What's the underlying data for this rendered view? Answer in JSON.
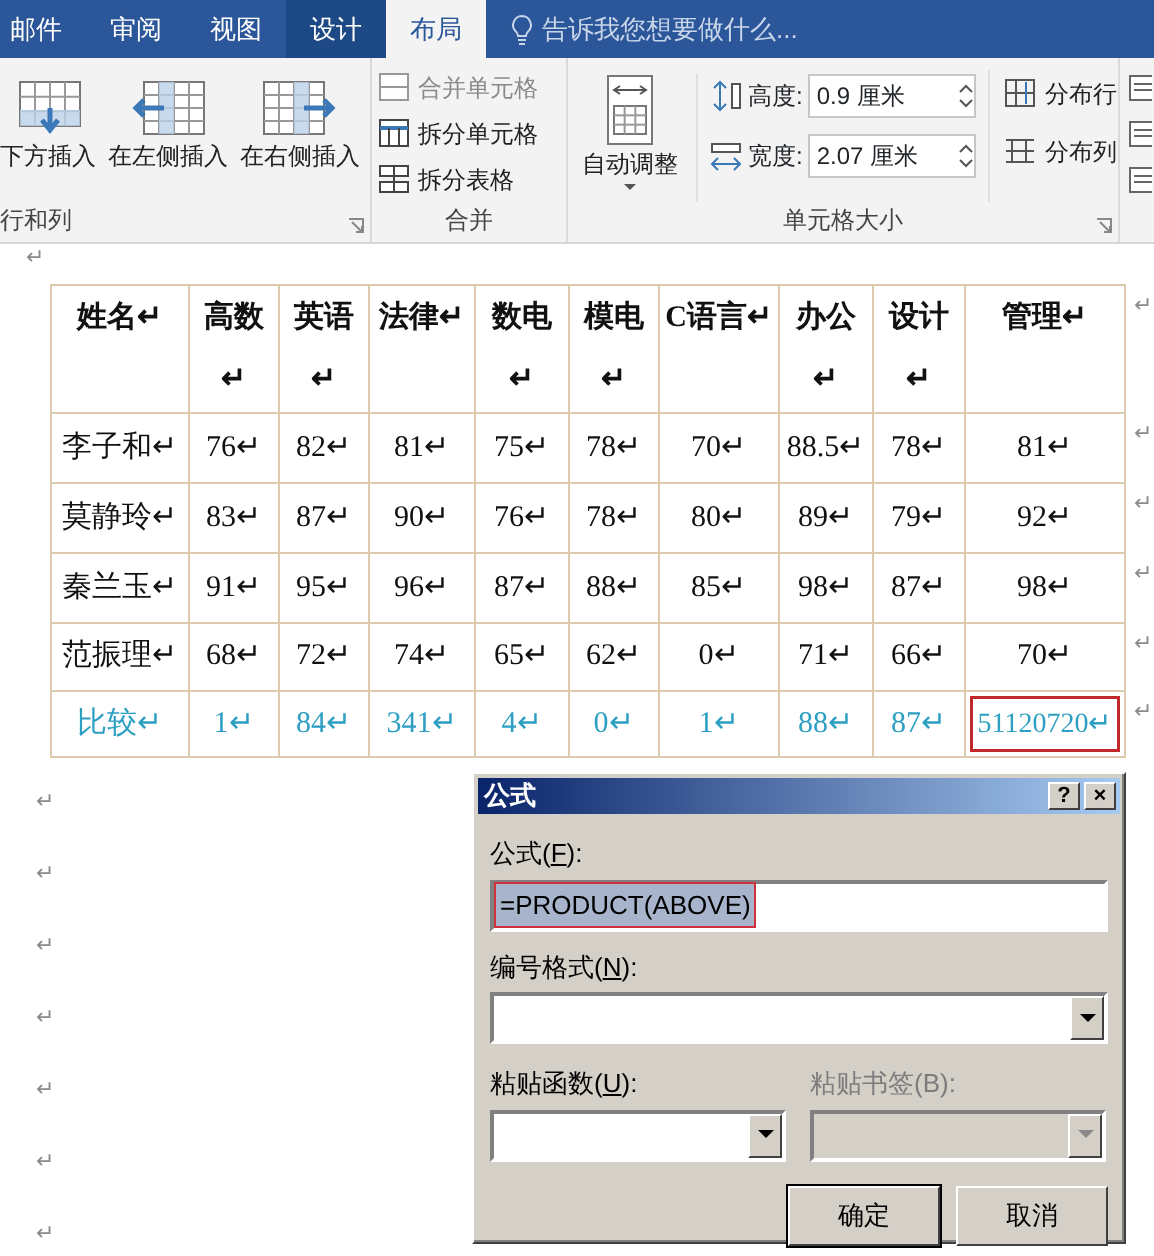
{
  "tabs": [
    {
      "label": "邮件",
      "contextual": false,
      "selected": false
    },
    {
      "label": "审阅",
      "contextual": false,
      "selected": false
    },
    {
      "label": "视图",
      "contextual": false,
      "selected": false
    },
    {
      "label": "设计",
      "contextual": true,
      "selected": false
    },
    {
      "label": "布局",
      "contextual": true,
      "selected": true
    }
  ],
  "tell_me": {
    "placeholder": "告诉我您想要做什么..."
  },
  "ribbon": {
    "rows_columns": {
      "label": "行和列",
      "buttons": [
        {
          "label": "下方插入"
        },
        {
          "label": "在左侧插入"
        },
        {
          "label": "在右侧插入"
        }
      ]
    },
    "merge": {
      "label": "合并",
      "buttons": [
        {
          "label": "合并单元格",
          "disabled": true
        },
        {
          "label": "拆分单元格",
          "disabled": false
        },
        {
          "label": "拆分表格",
          "disabled": false
        }
      ]
    },
    "cell_size": {
      "label": "单元格大小",
      "autofit": {
        "label": "自动调整"
      },
      "spins": [
        {
          "label": "高度:",
          "value": "0.9 厘米"
        },
        {
          "label": "宽度:",
          "value": "2.07 厘米"
        }
      ],
      "distribute": [
        {
          "label": "分布行"
        },
        {
          "label": "分布列"
        }
      ]
    }
  },
  "document": {
    "mark_before": "↵",
    "table": {
      "columns": [
        "姓名↵",
        "高数↵",
        "英语↵",
        "法律↵",
        "数电↵",
        "模电↵",
        "C语言↵",
        "办公↵",
        "设计↵",
        "管理↵"
      ],
      "header_end_mark": "↵",
      "rows": [
        {
          "kind": "data",
          "end_mark": "↵",
          "cells": [
            "李子和↵",
            "76↵",
            "82↵",
            "81↵",
            "75↵",
            "78↵",
            "70↵",
            "88.5↵",
            "78↵",
            "81↵"
          ]
        },
        {
          "kind": "data",
          "end_mark": "↵",
          "cells": [
            "莫静玲↵",
            "83↵",
            "87↵",
            "90↵",
            "76↵",
            "78↵",
            "80↵",
            "89↵",
            "79↵",
            "92↵"
          ]
        },
        {
          "kind": "data",
          "end_mark": "↵",
          "cells": [
            "秦兰玉↵",
            "91↵",
            "95↵",
            "96↵",
            "87↵",
            "88↵",
            "85↵",
            "98↵",
            "87↵",
            "98↵"
          ]
        },
        {
          "kind": "data",
          "end_mark": "↵",
          "cells": [
            "范振理↵",
            "68↵",
            "72↵",
            "74↵",
            "65↵",
            "62↵",
            "0↵",
            "71↵",
            "66↵",
            "70↵"
          ]
        },
        {
          "kind": "result",
          "end_mark": "↵",
          "cells": [
            {
              "text": "比较↵",
              "outlined": false
            },
            {
              "text": "1↵",
              "outlined": false
            },
            {
              "text": "84↵",
              "outlined": false
            },
            {
              "text": "341↵",
              "outlined": false
            },
            {
              "text": "4↵",
              "outlined": false
            },
            {
              "text": "0↵",
              "outlined": false
            },
            {
              "text": "1↵",
              "outlined": false
            },
            {
              "text": "88↵",
              "outlined": false
            },
            {
              "text": "87↵",
              "outlined": false
            },
            {
              "text": "51120720↵",
              "outlined": true
            }
          ]
        }
      ]
    },
    "marks_after": [
      "↵",
      "↵",
      "↵",
      "↵",
      "↵",
      "↵",
      "↵"
    ]
  },
  "dialog": {
    "title": "公式",
    "help": "?",
    "close": "×",
    "formula": {
      "label": {
        "before": "公式(",
        "key": "F",
        "after": "):"
      },
      "value": "=PRODUCT(ABOVE)",
      "selected": true,
      "outlined": true
    },
    "number_format": {
      "label": {
        "before": "编号格式(",
        "key": "N",
        "after": "):"
      }
    },
    "paste_function": {
      "label": {
        "before": "粘贴函数(",
        "key": "U",
        "after": "):"
      },
      "disabled": false
    },
    "paste_bookmark": {
      "label": {
        "before": "粘贴书签(B):"
      },
      "disabled": true
    },
    "buttons": [
      {
        "label": "确定",
        "default": true
      },
      {
        "label": "取消",
        "default": false
      }
    ]
  }
}
